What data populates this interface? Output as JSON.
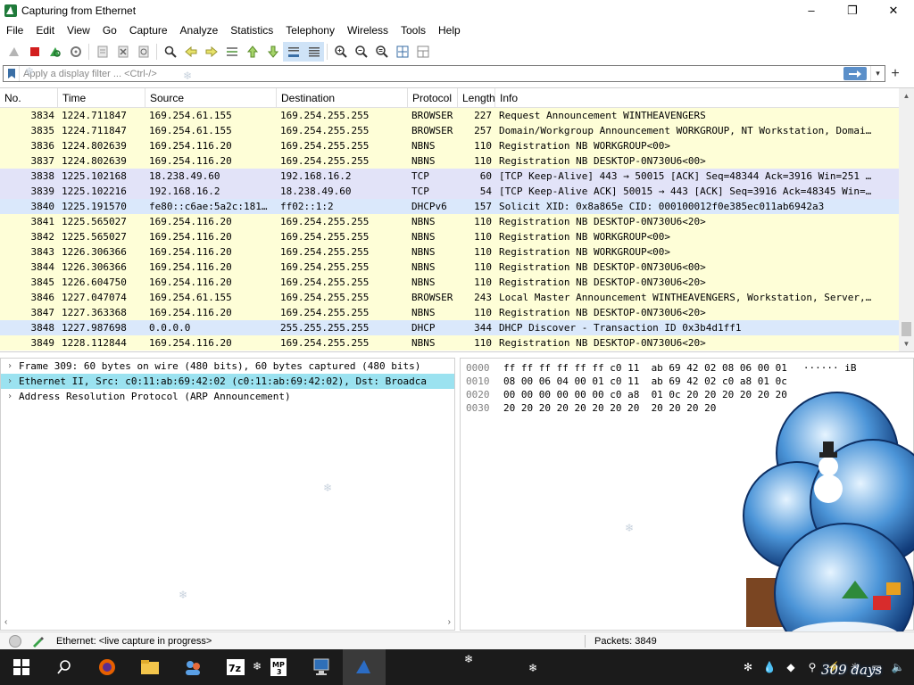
{
  "window": {
    "title": "Capturing from Ethernet",
    "minimize": "–",
    "maximize": "❐",
    "close": "✕"
  },
  "menu": [
    "File",
    "Edit",
    "View",
    "Go",
    "Capture",
    "Analyze",
    "Statistics",
    "Telephony",
    "Wireless",
    "Tools",
    "Help"
  ],
  "toolbar": {
    "icons": [
      "shark-fin-start-icon",
      "stop-capture-icon",
      "restart-capture-icon",
      "capture-options-icon",
      "open-file-icon",
      "close-file-icon",
      "reload-file-icon",
      "find-packet-icon",
      "go-back-icon",
      "go-forward-icon",
      "go-to-packet-icon",
      "go-first-icon",
      "go-last-icon",
      "auto-scroll-icon",
      "colorize-icon",
      "zoom-in-icon",
      "zoom-out-icon",
      "zoom-normal-icon",
      "resize-columns-icon",
      "layout-icon"
    ]
  },
  "filter": {
    "placeholder": "Apply a display filter ... <Ctrl-/>",
    "value": "",
    "add_label": "+"
  },
  "packet_list": {
    "columns": [
      "No.",
      "Time",
      "Source",
      "Destination",
      "Protocol",
      "Length",
      "Info"
    ],
    "rows": [
      {
        "no": "3834",
        "time": "1224.711847",
        "src": "169.254.61.155",
        "dst": "169.254.255.255",
        "proto": "BROWSER",
        "len": "227",
        "info": "Request Announcement WINTHEAVENGERS",
        "color": "yellow"
      },
      {
        "no": "3835",
        "time": "1224.711847",
        "src": "169.254.61.155",
        "dst": "169.254.255.255",
        "proto": "BROWSER",
        "len": "257",
        "info": "Domain/Workgroup Announcement WORKGROUP, NT Workstation, Domai…",
        "color": "yellow"
      },
      {
        "no": "3836",
        "time": "1224.802639",
        "src": "169.254.116.20",
        "dst": "169.254.255.255",
        "proto": "NBNS",
        "len": "110",
        "info": "Registration NB WORKGROUP<00>",
        "color": "yellow"
      },
      {
        "no": "3837",
        "time": "1224.802639",
        "src": "169.254.116.20",
        "dst": "169.254.255.255",
        "proto": "NBNS",
        "len": "110",
        "info": "Registration NB DESKTOP-0N730U6<00>",
        "color": "yellow"
      },
      {
        "no": "3838",
        "time": "1225.102168",
        "src": "18.238.49.60",
        "dst": "192.168.16.2",
        "proto": "TCP",
        "len": "60",
        "info": "[TCP Keep-Alive] 443 → 50015 [ACK] Seq=48344 Ack=3916 Win=251 …",
        "color": "purple"
      },
      {
        "no": "3839",
        "time": "1225.102216",
        "src": "192.168.16.2",
        "dst": "18.238.49.60",
        "proto": "TCP",
        "len": "54",
        "info": "[TCP Keep-Alive ACK] 50015 → 443 [ACK] Seq=3916 Ack=48345 Win=…",
        "color": "purple"
      },
      {
        "no": "3840",
        "time": "1225.191570",
        "src": "fe80::c6ae:5a2c:181…",
        "dst": "ff02::1:2",
        "proto": "DHCPv6",
        "len": "157",
        "info": "Solicit XID: 0x8a865e CID: 000100012f0e385ec011ab6942a3",
        "color": "blue"
      },
      {
        "no": "3841",
        "time": "1225.565027",
        "src": "169.254.116.20",
        "dst": "169.254.255.255",
        "proto": "NBNS",
        "len": "110",
        "info": "Registration NB DESKTOP-0N730U6<20>",
        "color": "yellow"
      },
      {
        "no": "3842",
        "time": "1225.565027",
        "src": "169.254.116.20",
        "dst": "169.254.255.255",
        "proto": "NBNS",
        "len": "110",
        "info": "Registration NB WORKGROUP<00>",
        "color": "yellow"
      },
      {
        "no": "3843",
        "time": "1226.306366",
        "src": "169.254.116.20",
        "dst": "169.254.255.255",
        "proto": "NBNS",
        "len": "110",
        "info": "Registration NB WORKGROUP<00>",
        "color": "yellow"
      },
      {
        "no": "3844",
        "time": "1226.306366",
        "src": "169.254.116.20",
        "dst": "169.254.255.255",
        "proto": "NBNS",
        "len": "110",
        "info": "Registration NB DESKTOP-0N730U6<00>",
        "color": "yellow"
      },
      {
        "no": "3845",
        "time": "1226.604750",
        "src": "169.254.116.20",
        "dst": "169.254.255.255",
        "proto": "NBNS",
        "len": "110",
        "info": "Registration NB DESKTOP-0N730U6<20>",
        "color": "yellow"
      },
      {
        "no": "3846",
        "time": "1227.047074",
        "src": "169.254.61.155",
        "dst": "169.254.255.255",
        "proto": "BROWSER",
        "len": "243",
        "info": "Local Master Announcement WINTHEAVENGERS, Workstation, Server,…",
        "color": "yellow"
      },
      {
        "no": "3847",
        "time": "1227.363368",
        "src": "169.254.116.20",
        "dst": "169.254.255.255",
        "proto": "NBNS",
        "len": "110",
        "info": "Registration NB DESKTOP-0N730U6<20>",
        "color": "yellow"
      },
      {
        "no": "3848",
        "time": "1227.987698",
        "src": "0.0.0.0",
        "dst": "255.255.255.255",
        "proto": "DHCP",
        "len": "344",
        "info": "DHCP Discover - Transaction ID 0x3b4d1ff1",
        "color": "blue"
      },
      {
        "no": "3849",
        "time": "1228.112844",
        "src": "169.254.116.20",
        "dst": "169.254.255.255",
        "proto": "NBNS",
        "len": "110",
        "info": "Registration NB DESKTOP-0N730U6<20>",
        "color": "yellow"
      }
    ]
  },
  "detail": {
    "items": [
      {
        "arrow": "›",
        "text": "Frame 309: 60 bytes on wire (480 bits), 60 bytes captured (480 bits)",
        "selected": false
      },
      {
        "arrow": "›",
        "text": "Ethernet II, Src: c0:11:ab:69:42:02 (c0:11:ab:69:42:02), Dst: Broadca",
        "selected": true
      },
      {
        "arrow": "›",
        "text": "Address Resolution Protocol (ARP Announcement)",
        "selected": false
      }
    ],
    "scroll_left": "‹",
    "scroll_right": "›"
  },
  "bytes": {
    "rows": [
      {
        "offset": "0000",
        "hex": "ff ff ff ff ff ff c0 11  ab 69 42 02 08 06 00 01",
        "ascii": "······ iB"
      },
      {
        "offset": "0010",
        "hex": "08 00 06 04 00 01 c0 11  ab 69 42 02 c0 a8 01 0c",
        "ascii": ""
      },
      {
        "offset": "0020",
        "hex": "00 00 00 00 00 00 c0 a8  01 0c 20 20 20 20 20 20",
        "ascii": ""
      },
      {
        "offset": "0030",
        "hex": "20 20 20 20 20 20 20 20  20 20 20 20",
        "ascii": ""
      }
    ]
  },
  "status": {
    "text": "Ethernet: <live capture in progress>",
    "packets": "Packets: 3849"
  },
  "taskbar": {
    "apps": [
      "windows-start-icon",
      "search-icon",
      "firefox-icon",
      "file-explorer-icon",
      "users-icon",
      "7zip-icon",
      "mp3-app-icon",
      "network-computer-icon",
      "wireshark-icon"
    ],
    "days_badge": "309 days"
  },
  "colors": {
    "row_yellow": "#fefed7",
    "row_purple": "#e2e3f8",
    "row_blue": "#dae8fb",
    "selected_tree": "#9be2f0",
    "accent": "#5b8fc9"
  }
}
